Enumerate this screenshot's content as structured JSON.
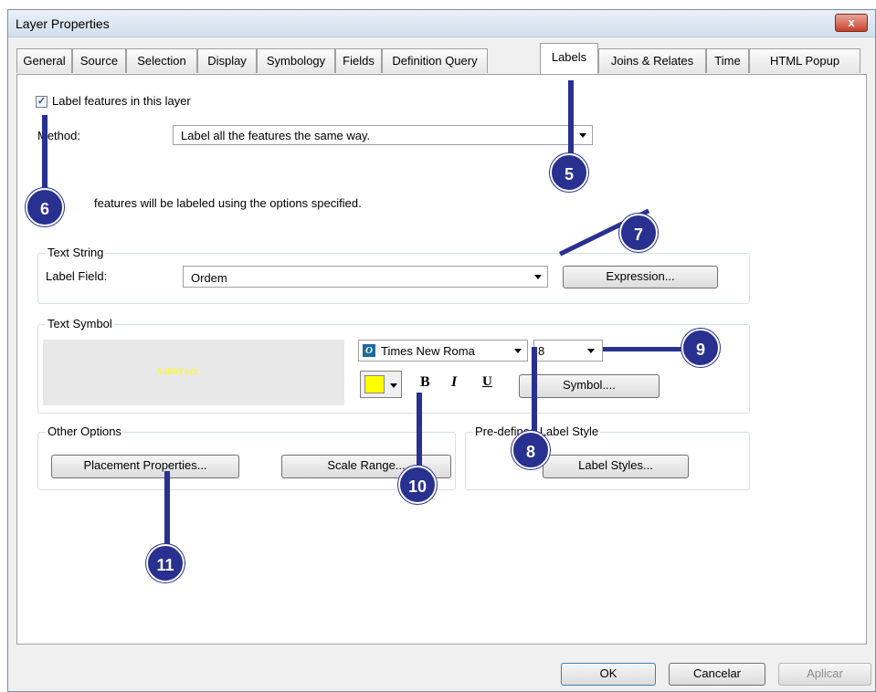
{
  "window": {
    "title": "Layer Properties",
    "close_glyph": "x"
  },
  "tabs": [
    {
      "label": "General"
    },
    {
      "label": "Source"
    },
    {
      "label": "Selection"
    },
    {
      "label": "Display"
    },
    {
      "label": "Symbology"
    },
    {
      "label": "Fields"
    },
    {
      "label": "Definition Query"
    },
    {
      "label": "Labels",
      "active": true
    },
    {
      "label": "Joins & Relates"
    },
    {
      "label": "Time"
    },
    {
      "label": "HTML Popup"
    }
  ],
  "labels_tab": {
    "label_features_checkbox": {
      "label": "Label features in this layer",
      "checked": true
    },
    "method_label": "Method:",
    "method_value": "Label all the features the same way.",
    "info_text": "features will be labeled using the options specified.",
    "text_string": {
      "title": "Text String",
      "label_field_label": "Label Field:",
      "label_field_value": "Ordem",
      "expression_button": "Expression..."
    },
    "text_symbol": {
      "title": "Text Symbol",
      "preview_text": "AaBbYyZz",
      "font_name": "Times New Roma",
      "font_size": "8",
      "color": "#ffff00",
      "bold": "B",
      "italic": "I",
      "underline": "U",
      "symbol_button": "Symbol...."
    },
    "other_options": {
      "title": "Other Options",
      "placement_button": "Placement Properties...",
      "scale_range_button": "Scale Range..."
    },
    "predefined_style": {
      "title": "Pre-defined Label Style",
      "label_styles_button": "Label Styles..."
    }
  },
  "footer": {
    "ok": "OK",
    "cancel": "Cancelar",
    "apply": "Aplicar"
  },
  "annotations": [
    "5",
    "6",
    "7",
    "8",
    "9",
    "10",
    "11"
  ],
  "colors": {
    "annotation": "#283090"
  }
}
